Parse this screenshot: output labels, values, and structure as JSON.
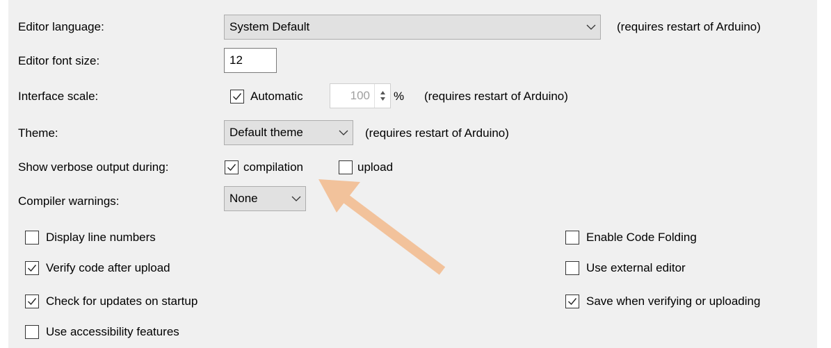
{
  "editor_language": {
    "label": "Editor language:",
    "value": "System Default",
    "note": "(requires restart of Arduino)"
  },
  "editor_font_size": {
    "label": "Editor font size:",
    "value": "12"
  },
  "interface_scale": {
    "label": "Interface scale:",
    "automatic_label": "Automatic",
    "automatic_checked": true,
    "scale_value": "100",
    "unit": "%",
    "note": "(requires restart of Arduino)"
  },
  "theme": {
    "label": "Theme:",
    "value": "Default theme",
    "note": "(requires restart of Arduino)"
  },
  "verbose_output": {
    "label": "Show verbose output during:",
    "compilation_label": "compilation",
    "compilation_checked": true,
    "upload_label": "upload",
    "upload_checked": false
  },
  "compiler_warnings": {
    "label": "Compiler warnings:",
    "value": "None"
  },
  "options": {
    "display_line_numbers": {
      "label": "Display line numbers",
      "checked": false
    },
    "verify_after_upload": {
      "label": "Verify code after upload",
      "checked": true
    },
    "check_updates": {
      "label": "Check for updates on startup",
      "checked": true
    },
    "accessibility": {
      "label": "Use accessibility features",
      "checked": false
    },
    "code_folding": {
      "label": "Enable Code Folding",
      "checked": false
    },
    "external_editor": {
      "label": "Use external editor",
      "checked": false
    },
    "save_when_verifying": {
      "label": "Save when verifying or uploading",
      "checked": true
    }
  },
  "colors": {
    "panel_background": "#f0f0f0",
    "annotation_arrow": "#f2c29b"
  },
  "icons": {
    "dropdown": "chevron-down-icon",
    "checkbox_mark": "checkmark-icon",
    "spinner": "spinner-arrows-icon",
    "annotation": "annotation-arrow-icon"
  }
}
